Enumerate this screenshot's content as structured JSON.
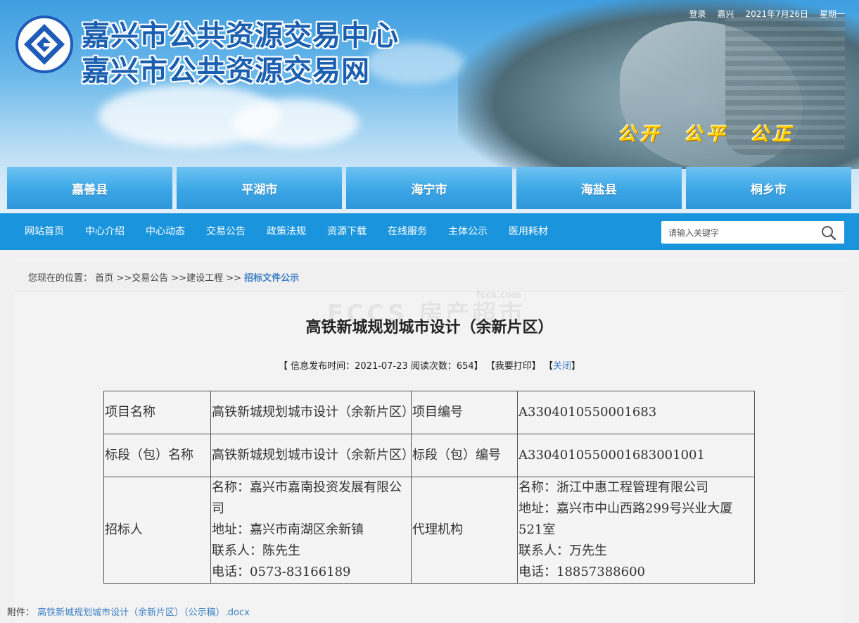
{
  "site": {
    "title_line1": "嘉兴市公共资源交易中心",
    "title_line2": "嘉兴市公共资源交易网",
    "slogan": "公开  公平  公正"
  },
  "topbar": {
    "login": "登录",
    "city": "嘉兴",
    "date": "2021年7月26日",
    "weekday": "星期一"
  },
  "cities": [
    "嘉善县",
    "平湖市",
    "海宁市",
    "海盐县",
    "桐乡市"
  ],
  "nav": {
    "items": [
      "网站首页",
      "中心介绍",
      "中心动态",
      "交易公告",
      "政策法规",
      "资源下载",
      "在线服务",
      "主体公示",
      "医用耗材"
    ]
  },
  "search": {
    "placeholder": "请输入关键字"
  },
  "breadcrumb": {
    "prefix": "您现在的位置：",
    "home": "首页",
    "sep": ">>",
    "level1": "交易公告",
    "level2": "建设工程",
    "current": "招标文件公示"
  },
  "watermark": {
    "text": "FCCS 房产超市",
    "domain": "fccs.com"
  },
  "article": {
    "title": "高铁新城规划城市设计（余新片区）",
    "meta_publish": "【 信息发布时间：2021-07-23  阅读次数：654】",
    "print": "【我要打印】",
    "close_l": "【",
    "close": "关闭",
    "close_r": "】"
  },
  "table": {
    "project_name_label": "项目名称",
    "project_name": "高铁新城规划城市设计（余新片区）",
    "project_no_label": "项目编号",
    "project_no": "A3304010550001683",
    "section_name_label": "标段（包）名称",
    "section_name": "高铁新城规划城市设计（余新片区）",
    "section_no_label": "标段（包）编号",
    "section_no": "A3304010550001683001001",
    "tenderer_label": "招标人",
    "tenderer": {
      "name": "名称：嘉兴市嘉南投资发展有限公司",
      "address": "地址：嘉兴市南湖区余新镇",
      "contact": "联系人：陈先生",
      "phone": "电话：0573-83166189"
    },
    "agency_label": "代理机构",
    "agency": {
      "name": "名称：浙江中惠工程管理有限公司",
      "address": "地址：嘉兴市中山西路299号兴业大厦521室",
      "contact": "联系人：万先生",
      "phone": "电话：18857388600"
    }
  },
  "attachment": {
    "label": "附件：",
    "file": "高铁新城规划城市设计（余新片区）（公示稿）.docx"
  },
  "colors": {
    "nav": "#1a95dd",
    "city_tab": "#3ba6e6",
    "slogan": "#ffd400",
    "link": "#3f7fc5"
  }
}
